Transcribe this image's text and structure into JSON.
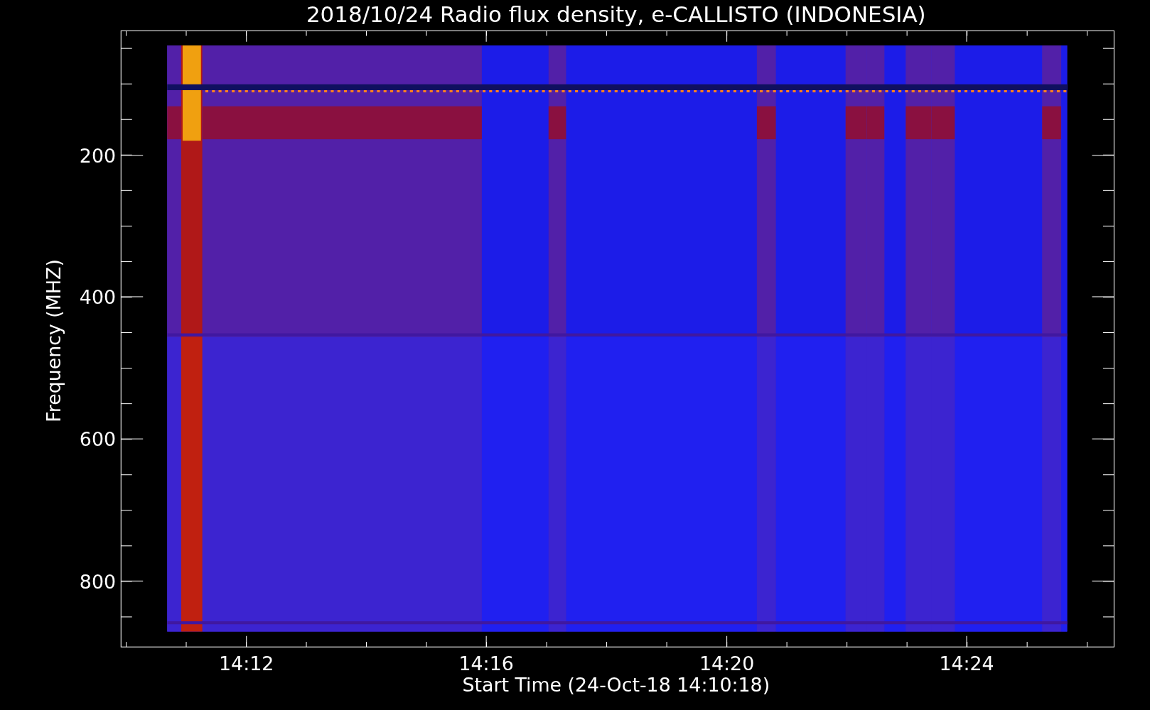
{
  "title": "2018/10/24  Radio flux density, e-CALLISTO (INDONESIA)",
  "y_axis": {
    "label": "Frequency (MHZ)",
    "ticks": [
      "200",
      "400",
      "600",
      "800"
    ]
  },
  "x_axis": {
    "label": "Start Time (24-Oct-18 14:10:18)",
    "ticks": [
      "14:12",
      "14:16",
      "14:20",
      "14:24"
    ]
  }
}
